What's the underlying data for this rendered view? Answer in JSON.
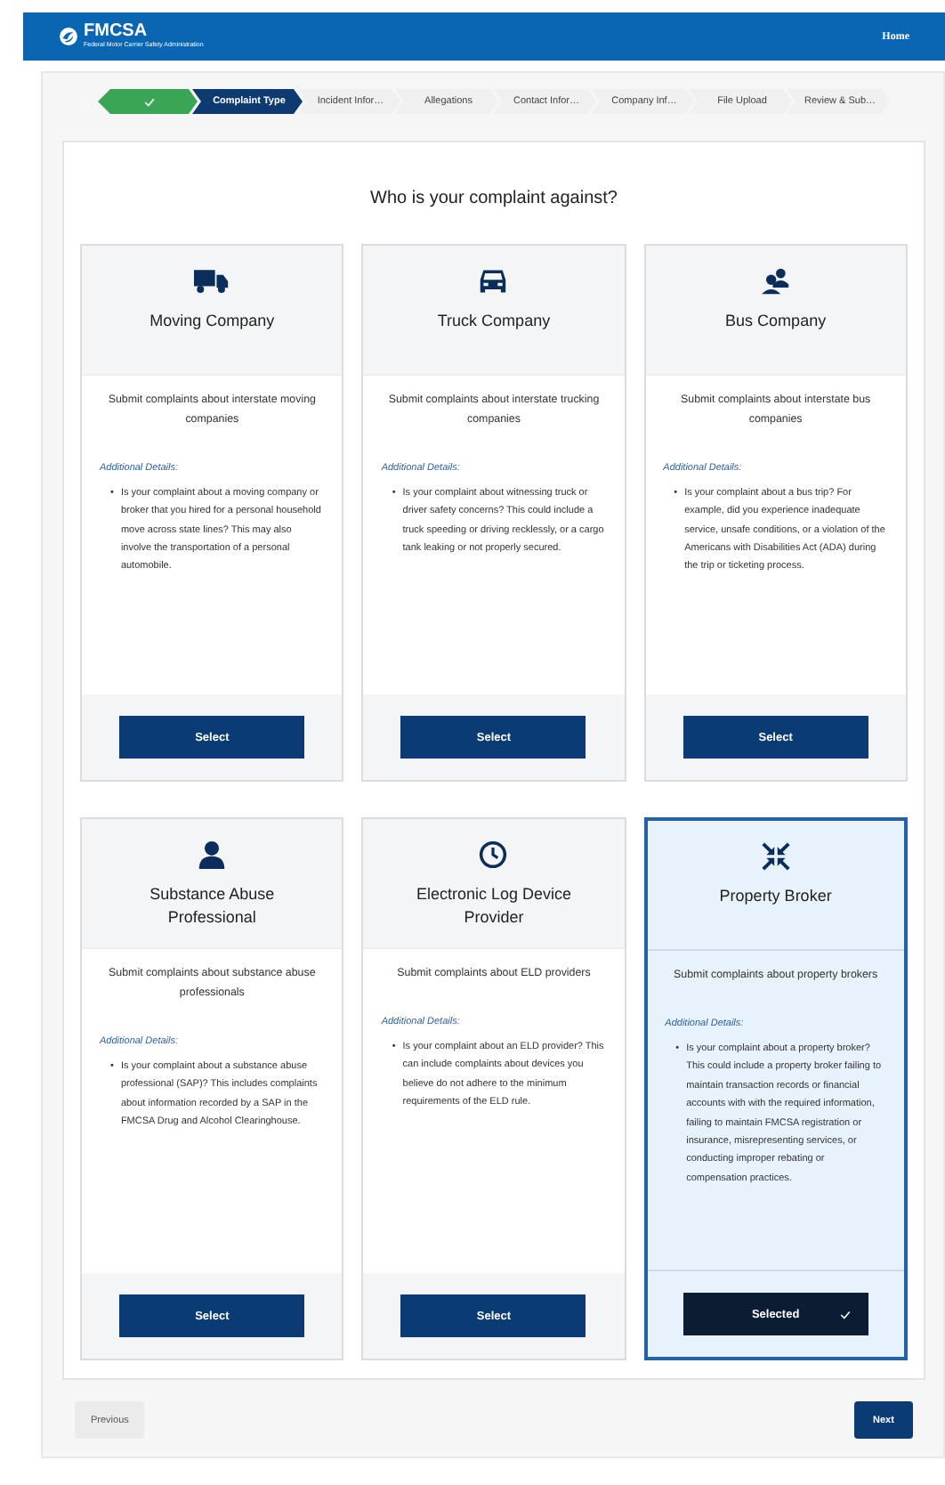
{
  "header": {
    "logo_title": "FMCSA",
    "logo_subtitle": "Federal Motor Carrier Safety Administration",
    "nav": [
      {
        "label": "Home"
      }
    ]
  },
  "steps": [
    {
      "completed": true,
      "selected": false
    },
    {
      "label": "Complaint Type",
      "completed": false,
      "selected": true
    },
    {
      "label": "Incident Infor…",
      "completed": false,
      "selected": false
    },
    {
      "label": "Allegations",
      "completed": false,
      "selected": false
    },
    {
      "label": "Contact Infor…",
      "completed": false,
      "selected": false
    },
    {
      "label": "Company Inf…",
      "completed": false,
      "selected": false
    },
    {
      "label": "File Upload",
      "completed": false,
      "selected": false
    },
    {
      "label": "Review & Sub…",
      "completed": false,
      "selected": false
    }
  ],
  "question": "Who is your complaint against?",
  "cards": [
    {
      "title": "Moving Company",
      "summary": "Submit complaints about interstate moving companies",
      "details_label": "Additional Details:",
      "details": [
        {
          "marker": "•",
          "text": "Is your complaint about a moving company or broker that you hired for a personal household move across state lines? This may also involve the transportation of a personal automobile."
        }
      ],
      "button": "Select",
      "selected": false
    },
    {
      "title": "Truck Company",
      "summary": "Submit complaints about interstate trucking companies",
      "details_label": "Additional Details:",
      "details": [
        {
          "marker": "•",
          "text": "Is your complaint about witnessing truck or driver safety concerns? This could include a truck speeding or driving recklessly, or a cargo tank leaking or not properly secured."
        }
      ],
      "button": "Select",
      "selected": false
    },
    {
      "title": "Bus Company",
      "summary": "Submit complaints about interstate bus companies",
      "details_label": "Additional Details:",
      "details": [
        {
          "marker": "•",
          "text": "Is your complaint about a bus trip? For example, did you experience inadequate service, unsafe conditions, or a violation of the Americans with Disabilities Act (ADA) during the trip or ticketing process."
        }
      ],
      "button": "Select",
      "selected": false
    },
    {
      "title": "Substance Abuse Professional",
      "summary": "Submit complaints about substance abuse professionals",
      "details_label": "Additional Details:",
      "details": [
        {
          "marker": "•",
          "text": "Is your complaint about a substance abuse professional (SAP)? This includes complaints about information recorded by a SAP in the FMCSA Drug and Alcohol Clearinghouse."
        }
      ],
      "button": "Select",
      "selected": false
    },
    {
      "title": "Electronic Log Device Provider",
      "summary": "Submit complaints about ELD providers",
      "details_label": "Additional Details:",
      "details": [
        {
          "marker": "•",
          "text": "Is your complaint about an ELD provider? This can include complaints about devices you believe do not adhere to the minimum requirements of the ELD rule."
        }
      ],
      "button": "Select",
      "selected": false
    },
    {
      "title": "Property Broker",
      "summary": "Submit complaints about property brokers",
      "details_label": "Additional Details:",
      "details": [
        {
          "marker": "•",
          "text": "Is your complaint about a property broker? This could include a property broker failing to maintain transaction records or financial accounts with with the required information, failing to maintain FMCSA registration or insurance, misrepresenting services, or conducting improper rebating or compensation practices."
        }
      ],
      "button": "Selected",
      "selected": true
    }
  ],
  "footer": {
    "previous": "Previous",
    "next": "Next"
  }
}
